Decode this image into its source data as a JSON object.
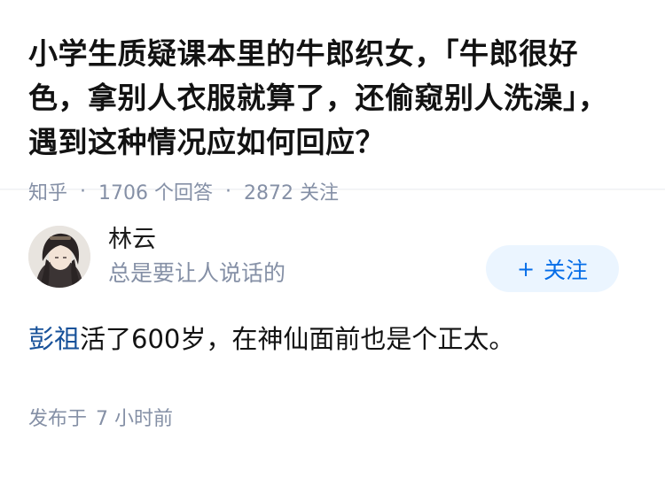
{
  "question": {
    "title": "小学生质疑课本里的牛郎织女，「牛郎很好色，拿别人衣服就算了，还偷窥别人洗澡」，遇到这种情况应如何回应？",
    "source": "知乎",
    "answer_count": "1706 个回答",
    "follower_count": "2872 关注"
  },
  "answer": {
    "author": {
      "name": "林云",
      "bio": "总是要让人说话的",
      "avatar_icon": "avatar-portrait"
    },
    "follow_label": "关注",
    "follow_plus": "+",
    "content": {
      "link_text": "彭祖",
      "text": "活了600岁，在神仙面前也是个正太。"
    },
    "published_label": "发布于",
    "published_time": "7 小时前"
  },
  "colors": {
    "link": "#175199",
    "muted": "#8590a6",
    "follow_bg": "#ebf5ff",
    "follow_text": "#056de8"
  }
}
